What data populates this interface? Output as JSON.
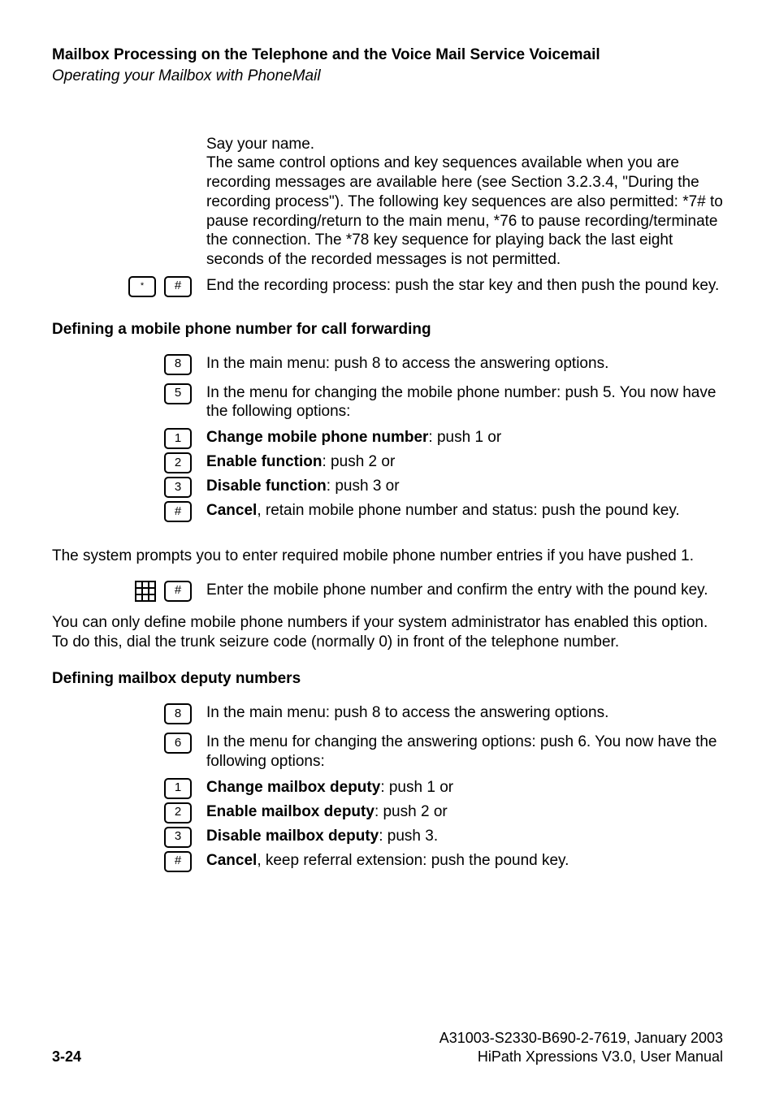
{
  "header": {
    "title": "Mailbox Processing on the Telephone and the Voice Mail Service Voicemail",
    "subtitle": "Operating your Mailbox with PhoneMail"
  },
  "intro": {
    "line1": "Say your name.",
    "line2": "The same control options and key sequences available when you are recording messages are available here (see Section 3.2.3.4, \"During the recording process\"). The following key sequences are also permitted: *7# to pause recording/return to the main menu, *76 to pause recording/terminate the connection. The *78 key sequence for playing back the last eight seconds of the recorded messages is not permitted."
  },
  "starpound": {
    "star": "*",
    "pound": "#",
    "text": "End the recording process: push the star key and then push the pound key."
  },
  "section1": {
    "heading": "Defining a mobile phone number for call forwarding",
    "items": {
      "a": {
        "key": "8",
        "text": "In the main menu: push 8 to access the answering options."
      },
      "b": {
        "key": "5",
        "text": "In the menu for changing the mobile phone number: push 5. You now have the following options:"
      },
      "c": {
        "key": "1",
        "bold": "Change mobile phone number",
        "rest": ": push 1 or"
      },
      "d": {
        "key": "2",
        "bold": "Enable function",
        "rest": ": push 2 or"
      },
      "e": {
        "key": "3",
        "bold": "Disable function",
        "rest": ": push 3 or"
      },
      "f": {
        "key": "#",
        "bold": "Cancel",
        "rest": ", retain mobile phone number and status: push the pound key."
      }
    },
    "after1": "The system prompts you to enter required mobile phone number entries if you have pushed 1.",
    "padkey": "#",
    "padtext": "Enter the mobile phone number and confirm the entry with the pound key.",
    "after2": "You can only define mobile phone numbers if your system administrator has enabled this option. To do this, dial the trunk seizure code (normally 0) in front of the telephone number."
  },
  "section2": {
    "heading": "Defining mailbox deputy numbers",
    "items": {
      "a": {
        "key": "8",
        "text": "In the main menu: push 8 to access the answering options."
      },
      "b": {
        "key": "6",
        "text": "In the menu for changing the answering options: push 6. You now have the following options:"
      },
      "c": {
        "key": "1",
        "bold": "Change mailbox deputy",
        "rest": ": push 1 or"
      },
      "d": {
        "key": "2",
        "bold": "Enable mailbox deputy",
        "rest": ": push 2 or"
      },
      "e": {
        "key": "3",
        "bold": "Disable mailbox deputy",
        "rest": ": push 3."
      },
      "f": {
        "key": "#",
        "bold": "Cancel",
        "rest": ", keep referral extension: push the pound key."
      }
    }
  },
  "footer": {
    "left": "3-24",
    "right1": "A31003-S2330-B690-2-7619, January 2003",
    "right2": "HiPath Xpressions V3.0, User Manual"
  }
}
